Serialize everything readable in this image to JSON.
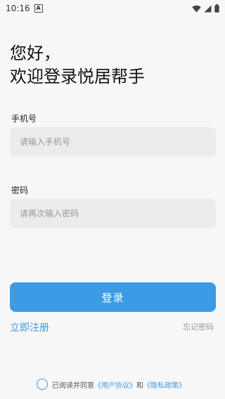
{
  "status_bar": {
    "time": "10:16",
    "app_badge": "A",
    "icons": [
      "wifi-icon",
      "signal-icon",
      "battery-icon"
    ]
  },
  "greeting": {
    "line1": "您好，",
    "line2": "欢迎登录悦居帮手"
  },
  "phone": {
    "label": "手机号",
    "placeholder": "请输入手机号",
    "value": ""
  },
  "password": {
    "label": "密码",
    "placeholder": "请再次输入密码",
    "value": ""
  },
  "login_button": "登录",
  "register_link": "立即注册",
  "forgot_link": "忘记密码",
  "agreement": {
    "checked": false,
    "prefix": "已阅读并同意",
    "user_agreement": "《用户协议》",
    "and": "和",
    "privacy_policy": "《隐私政策》"
  },
  "colors": {
    "accent": "#3b9be4",
    "background": "#f7f7f7",
    "input_bg": "#ececec"
  }
}
